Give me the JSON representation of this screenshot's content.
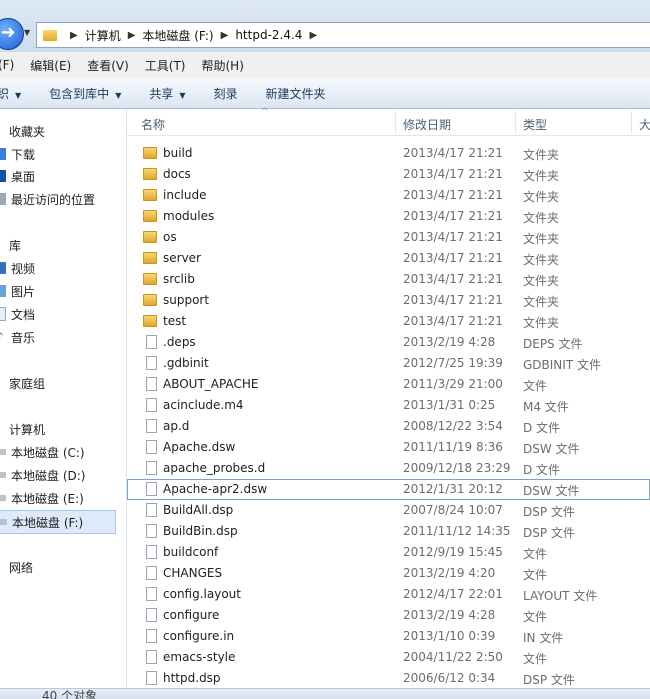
{
  "address": {
    "crumbs": [
      "计算机",
      "本地磁盘 (F:)",
      "httpd-2.4.4"
    ]
  },
  "menu": [
    "(F)",
    "编辑(E)",
    "查看(V)",
    "工具(T)",
    "帮助(H)"
  ],
  "toolbar": {
    "organize": "织",
    "include_library": "包含到库中",
    "share": "共享",
    "burn": "刻录",
    "new_folder": "新建文件夹"
  },
  "nav": {
    "favorites": "收藏夹",
    "download": "下载",
    "desktop": "桌面",
    "recent": "最近访问的位置",
    "libraries": "库",
    "videos": "视频",
    "pictures": "图片",
    "documents": "文档",
    "music": "音乐",
    "homegroup": "家庭组",
    "computer": "计算机",
    "drive_c": "本地磁盘 (C:)",
    "drive_d": "本地磁盘 (D:)",
    "drive_e": "本地磁盘 (E:)",
    "drive_f": "本地磁盘 (F:)",
    "network": "网络"
  },
  "columns": {
    "name": "名称",
    "modified": "修改日期",
    "type": "类型",
    "size": "大"
  },
  "files": [
    {
      "name": "build",
      "date": "2013/4/17 21:21",
      "type": "文件夹",
      "kind": "folder"
    },
    {
      "name": "docs",
      "date": "2013/4/17 21:21",
      "type": "文件夹",
      "kind": "folder"
    },
    {
      "name": "include",
      "date": "2013/4/17 21:21",
      "type": "文件夹",
      "kind": "folder"
    },
    {
      "name": "modules",
      "date": "2013/4/17 21:21",
      "type": "文件夹",
      "kind": "folder"
    },
    {
      "name": "os",
      "date": "2013/4/17 21:21",
      "type": "文件夹",
      "kind": "folder"
    },
    {
      "name": "server",
      "date": "2013/4/17 21:21",
      "type": "文件夹",
      "kind": "folder"
    },
    {
      "name": "srclib",
      "date": "2013/4/17 21:21",
      "type": "文件夹",
      "kind": "folder"
    },
    {
      "name": "support",
      "date": "2013/4/17 21:21",
      "type": "文件夹",
      "kind": "folder"
    },
    {
      "name": "test",
      "date": "2013/4/17 21:21",
      "type": "文件夹",
      "kind": "folder"
    },
    {
      "name": ".deps",
      "date": "2013/2/19 4:28",
      "type": "DEPS 文件",
      "kind": "file"
    },
    {
      "name": ".gdbinit",
      "date": "2012/7/25 19:39",
      "type": "GDBINIT 文件",
      "kind": "file"
    },
    {
      "name": "ABOUT_APACHE",
      "date": "2011/3/29 21:00",
      "type": "文件",
      "kind": "file"
    },
    {
      "name": "acinclude.m4",
      "date": "2013/1/31 0:25",
      "type": "M4 文件",
      "kind": "file"
    },
    {
      "name": "ap.d",
      "date": "2008/12/22 3:54",
      "type": "D 文件",
      "kind": "file"
    },
    {
      "name": "Apache.dsw",
      "date": "2011/11/19 8:36",
      "type": "DSW 文件",
      "kind": "file"
    },
    {
      "name": "apache_probes.d",
      "date": "2009/12/18 23:29",
      "type": "D 文件",
      "kind": "file"
    },
    {
      "name": "Apache-apr2.dsw",
      "date": "2012/1/31 20:12",
      "type": "DSW 文件",
      "kind": "file"
    },
    {
      "name": "BuildAll.dsp",
      "date": "2007/8/24 10:07",
      "type": "DSP 文件",
      "kind": "file"
    },
    {
      "name": "BuildBin.dsp",
      "date": "2011/11/12 14:35",
      "type": "DSP 文件",
      "kind": "file"
    },
    {
      "name": "buildconf",
      "date": "2012/9/19 15:45",
      "type": "文件",
      "kind": "file"
    },
    {
      "name": "CHANGES",
      "date": "2013/2/19 4:20",
      "type": "文件",
      "kind": "file"
    },
    {
      "name": "config.layout",
      "date": "2012/4/17 22:01",
      "type": "LAYOUT 文件",
      "kind": "file"
    },
    {
      "name": "configure",
      "date": "2013/2/19 4:28",
      "type": "文件",
      "kind": "file"
    },
    {
      "name": "configure.in",
      "date": "2013/1/10 0:39",
      "type": "IN 文件",
      "kind": "file"
    },
    {
      "name": "emacs-style",
      "date": "2004/11/22 2:50",
      "type": "文件",
      "kind": "file"
    },
    {
      "name": "httpd.dsp",
      "date": "2006/6/12 0:34",
      "type": "DSP 文件",
      "kind": "file"
    }
  ],
  "status": {
    "count": "40 个对象"
  }
}
